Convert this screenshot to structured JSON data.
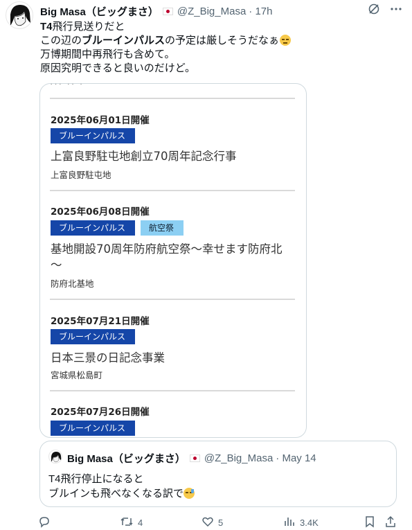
{
  "tweet": {
    "author_name": "Big Masa（ビッグまさ）",
    "handle": "@Z_Big_Masa",
    "time": "· 17h",
    "line1_bold": "T4",
    "line1_rest": "飛行見送りだと",
    "line2_pre": "この辺の",
    "line2_bold": "ブルーインパルス",
    "line2_post": "の予定は厳しそうだなぁ",
    "line3": "万博期間中再飛行も含めて。",
    "line4": "原因究明できると良いのだけど。"
  },
  "media": {
    "events": [
      {
        "date": "2025年06月01日開催",
        "tags": [
          "ブルーインパルス"
        ],
        "title": "上富良野駐屯地創立70周年記念行事",
        "location": "上富良野駐屯地"
      },
      {
        "date": "2025年06月08日開催",
        "tags": [
          "ブルーインパルス",
          "航空祭"
        ],
        "title_line1": "基地開設70周年防府航空祭～幸せます防府北",
        "title_line2": "～",
        "location": "防府北基地"
      },
      {
        "date": "2025年07月21日開催",
        "tags": [
          "ブルーインパルス"
        ],
        "title": "日本三景の日記念事業",
        "location": "宮城県松島町"
      },
      {
        "date": "2025年07月26日開催",
        "tags": [
          "ブルーインパルス"
        ]
      }
    ]
  },
  "quote": {
    "author_name": "Big Masa（ビッグまさ）",
    "handle": "@Z_Big_Masa",
    "time": "· May 14",
    "line1": "T4飛行停止になると",
    "line2": "ブルインも飛べなくなる訳で"
  },
  "actions": {
    "reply_count": "",
    "retweet_count": "4",
    "like_count": "5",
    "views_count": "3.4K"
  },
  "icons": {
    "grok": "grok-icon",
    "more": "more-icon",
    "reply": "reply-icon",
    "retweet": "retweet-icon",
    "like": "heart-icon",
    "views": "views-icon",
    "bookmark": "bookmark-icon",
    "share": "share-icon"
  },
  "colors": {
    "tag_blue": "#1546a8",
    "tag_light": "#8ccff3",
    "muted": "#536471"
  }
}
